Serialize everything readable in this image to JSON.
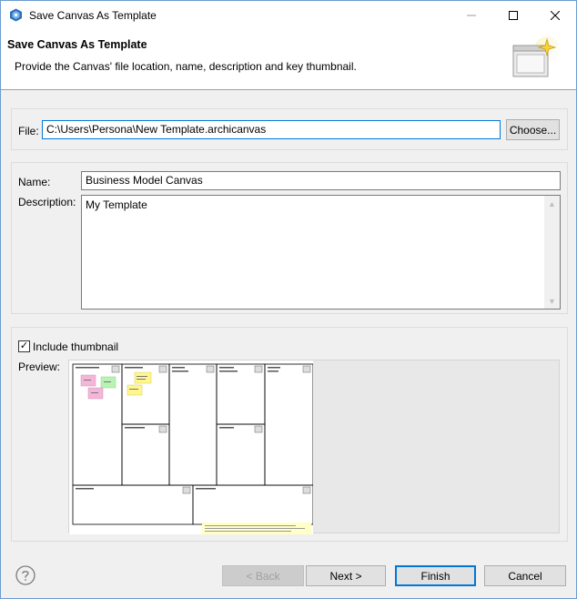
{
  "window": {
    "title": "Save Canvas As Template"
  },
  "header": {
    "title": "Save Canvas As Template",
    "description": "Provide the Canvas' file location, name, description and key thumbnail."
  },
  "file": {
    "label": "File:",
    "value": "C:\\Users\\Persona\\New Template.archicanvas",
    "choose_label": "Choose..."
  },
  "details": {
    "name_label": "Name:",
    "name_value": "Business Model Canvas",
    "description_label": "Description:",
    "description_value": "My Template"
  },
  "thumbnail": {
    "include_label": "Include thumbnail",
    "include_checked": true,
    "preview_label": "Preview:"
  },
  "buttons": {
    "back": "< Back",
    "next": "Next >",
    "finish": "Finish",
    "cancel": "Cancel"
  },
  "colors": {
    "accent": "#0078d7",
    "sticky_pink": "#f4b6d8",
    "sticky_green": "#b9f3b4",
    "sticky_yellow": "#fff68f",
    "note_yellow": "#ffffc6"
  }
}
